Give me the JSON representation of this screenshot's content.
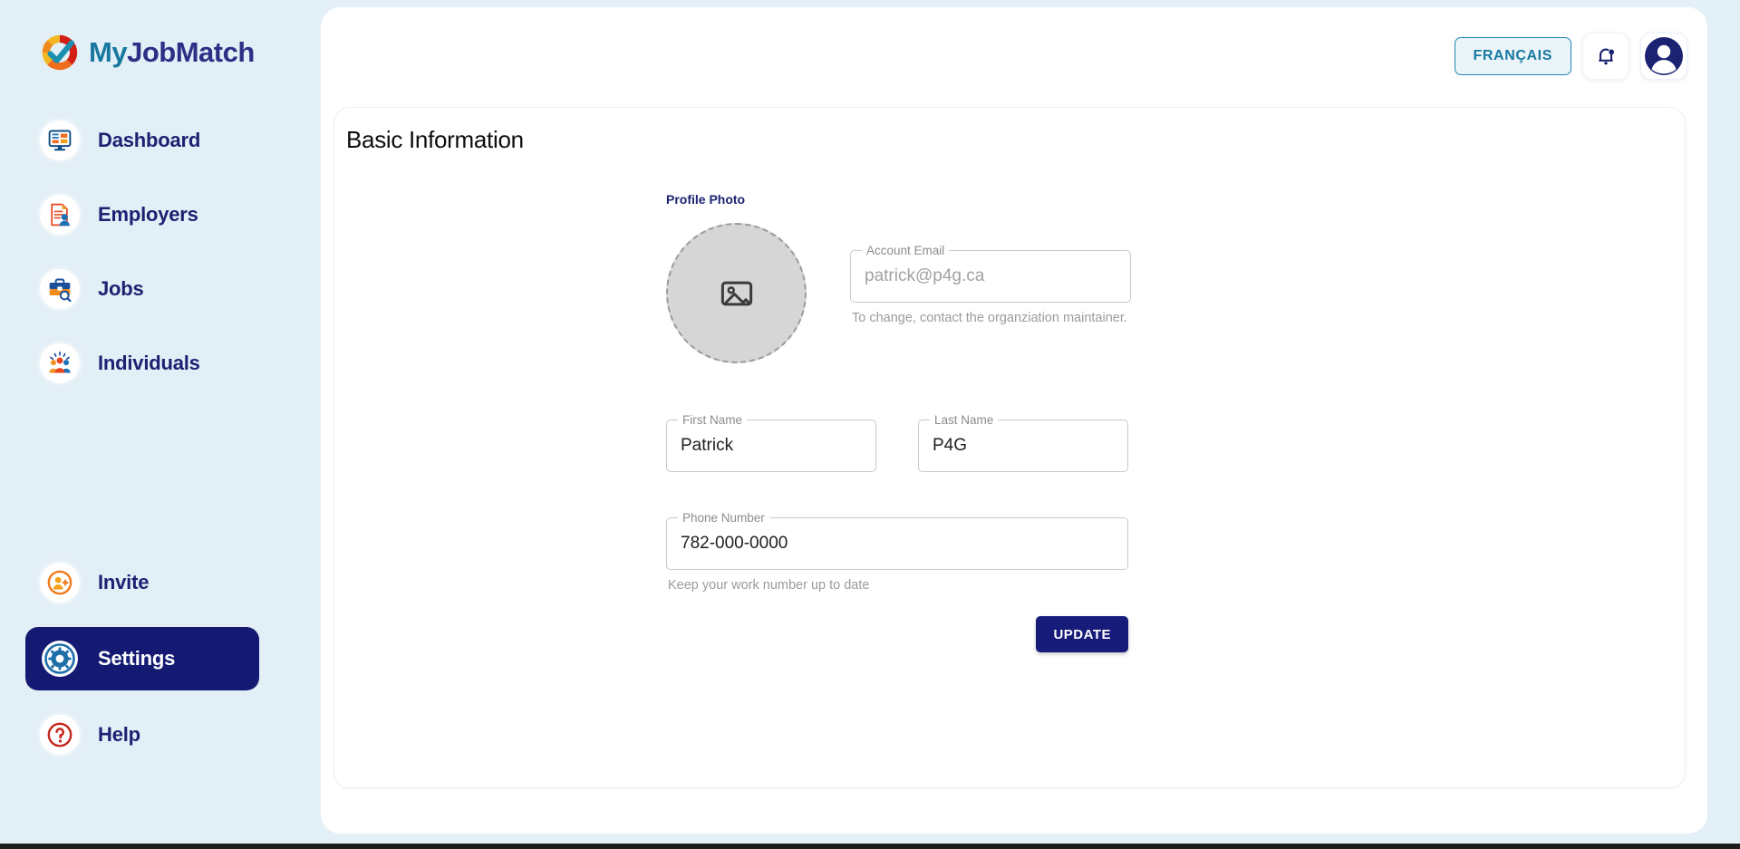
{
  "brand": {
    "name_part1": "My",
    "name_part2": "JobMatch",
    "logo_icon": "checkmark-circle-logo",
    "color_teal": "#1878a0",
    "color_navy": "#2b2f86"
  },
  "sidebar": {
    "background": "#e2eff6",
    "main_items": [
      {
        "label": "Dashboard",
        "icon": "monitor-dashboard-icon",
        "active": false
      },
      {
        "label": "Employers",
        "icon": "document-person-icon",
        "active": false
      },
      {
        "label": "Jobs",
        "icon": "briefcase-search-icon",
        "active": false
      },
      {
        "label": "Individuals",
        "icon": "people-group-icon",
        "active": false
      }
    ],
    "bottom_items": [
      {
        "label": "Invite",
        "icon": "person-add-icon",
        "active": false
      },
      {
        "label": "Settings",
        "icon": "gear-icon",
        "active": true
      },
      {
        "label": "Help",
        "icon": "question-mark-circle-icon",
        "active": false
      }
    ],
    "active_bg": "#141a72",
    "active_text": "#ffffff"
  },
  "topbar": {
    "language_button": "FRANÇAIS",
    "language_border": "#1c87ae",
    "notifications_icon": "bell-icon",
    "notifications_has_badge": true,
    "avatar_icon": "user-avatar-icon"
  },
  "card": {
    "title": "Basic Information"
  },
  "form": {
    "profile_photo_label": "Profile Photo",
    "photo_placeholder_icon": "image-placeholder-icon",
    "fields": {
      "account_email": {
        "label": "Account Email",
        "value": "",
        "placeholder": "patrick@p4g.ca",
        "helper": "To change, contact the organziation maintainer.",
        "disabled": true
      },
      "first_name": {
        "label": "First Name",
        "value": "Patrick",
        "placeholder": ""
      },
      "last_name": {
        "label": "Last Name",
        "value": "P4G",
        "placeholder": ""
      },
      "phone_number": {
        "label": "Phone Number",
        "value": "782-000-0000",
        "placeholder": "",
        "helper": "Keep your work number up to date"
      }
    },
    "submit_button": "UPDATE",
    "submit_color": "#171b7a"
  }
}
